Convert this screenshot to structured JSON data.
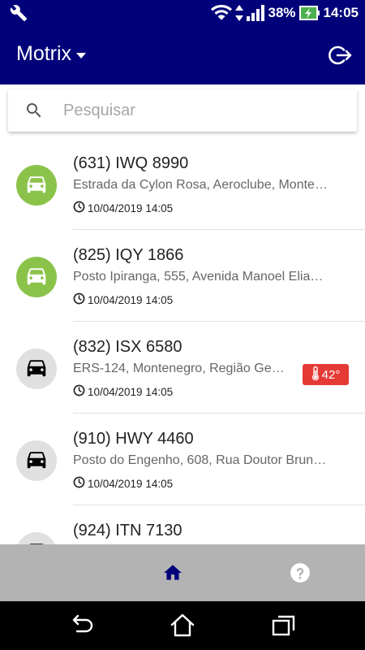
{
  "status_bar": {
    "battery": "38%",
    "time": "14:05"
  },
  "app_bar": {
    "title": "Motrix"
  },
  "search": {
    "placeholder": "Pesquisar"
  },
  "vehicles": [
    {
      "plate": "(631) IWQ 8990",
      "address": "Estrada da Cylon Rosa, Aeroclube, Monte…",
      "timestamp": "10/04/2019 14:05",
      "status": "moving",
      "status_color": "#8bc34a"
    },
    {
      "plate": "(825) IQY 1866",
      "address": "Posto Ipiranga, 555, Avenida Manoel Elia…",
      "timestamp": "10/04/2019 14:05",
      "status": "moving",
      "status_color": "#8bc34a"
    },
    {
      "plate": "(832) ISX 6580",
      "address": "ERS-124, Montenegro, Região Ge…",
      "timestamp": "10/04/2019 14:05",
      "status": "stopped",
      "status_color": "#e0e0e0",
      "temperature": "42°"
    },
    {
      "plate": "(910) HWY 4460",
      "address": "Posto do Engenho, 608, Rua Doutor Brun…",
      "timestamp": "10/04/2019 14:05",
      "status": "stopped",
      "status_color": "#e0e0e0"
    },
    {
      "plate": "(924) ITN 7130",
      "address": "",
      "timestamp": "",
      "status": "stopped",
      "status_color": "#e0e0e0"
    }
  ],
  "colors": {
    "primary": "#01017a",
    "moving": "#8bc34a",
    "stopped": "#e0e0e0",
    "alert": "#e53935",
    "bottom_nav_bg": "#b3b3b3"
  },
  "icons": {
    "status_left": "wrench-icon",
    "vehicle": "car-icon",
    "time": "clock-icon",
    "temperature": "thermometer-icon",
    "logout": "logout-icon",
    "search": "search-icon",
    "home_tab": "home-icon",
    "help_tab": "help-icon"
  }
}
